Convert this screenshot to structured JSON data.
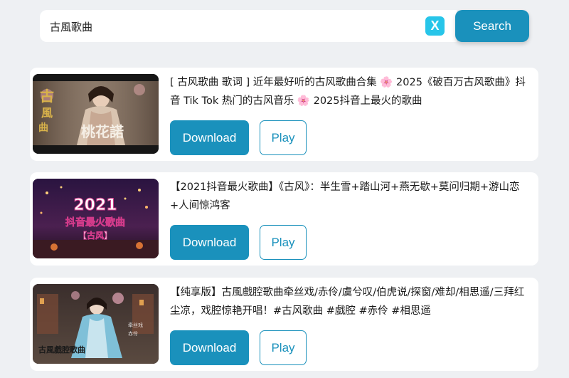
{
  "search": {
    "value": "古風歌曲",
    "placeholder": "",
    "clear_label": "X",
    "button_label": "Search"
  },
  "results": [
    {
      "title": "[ 古风歌曲 歌词 ] 近年最好听的古风歌曲合集 🌸 2025《破百万古风歌曲》抖音 Tik Tok 热门的古风音乐 🌸 2025抖音上最火的歌曲",
      "thumb_text": "桃花諾",
      "download_label": "Download",
      "play_label": "Play"
    },
    {
      "title": "【2021抖音最火歌曲】《古风》：半生雪+踏山河+燕无歇+莫问归期+游山恋+人间惊鸿客",
      "thumb_text": [
        "2021",
        "抖音最火歌曲",
        "【古风】"
      ],
      "download_label": "Download",
      "play_label": "Play"
    },
    {
      "title": "【纯享版】古風戲腔歌曲牵丝戏/赤伶/虞兮叹/伯虎说/探窗/难却/相思遥/三拜红尘凉，戏腔惊艳开唱！#古风歌曲 #戲腔 #赤伶 #相思遥",
      "thumb_text": "古風戲腔歌曲",
      "download_label": "Download",
      "play_label": "Play"
    }
  ],
  "colors": {
    "accent": "#1a91bc",
    "clear": "#27c5e9",
    "background": "#eef0f3"
  }
}
